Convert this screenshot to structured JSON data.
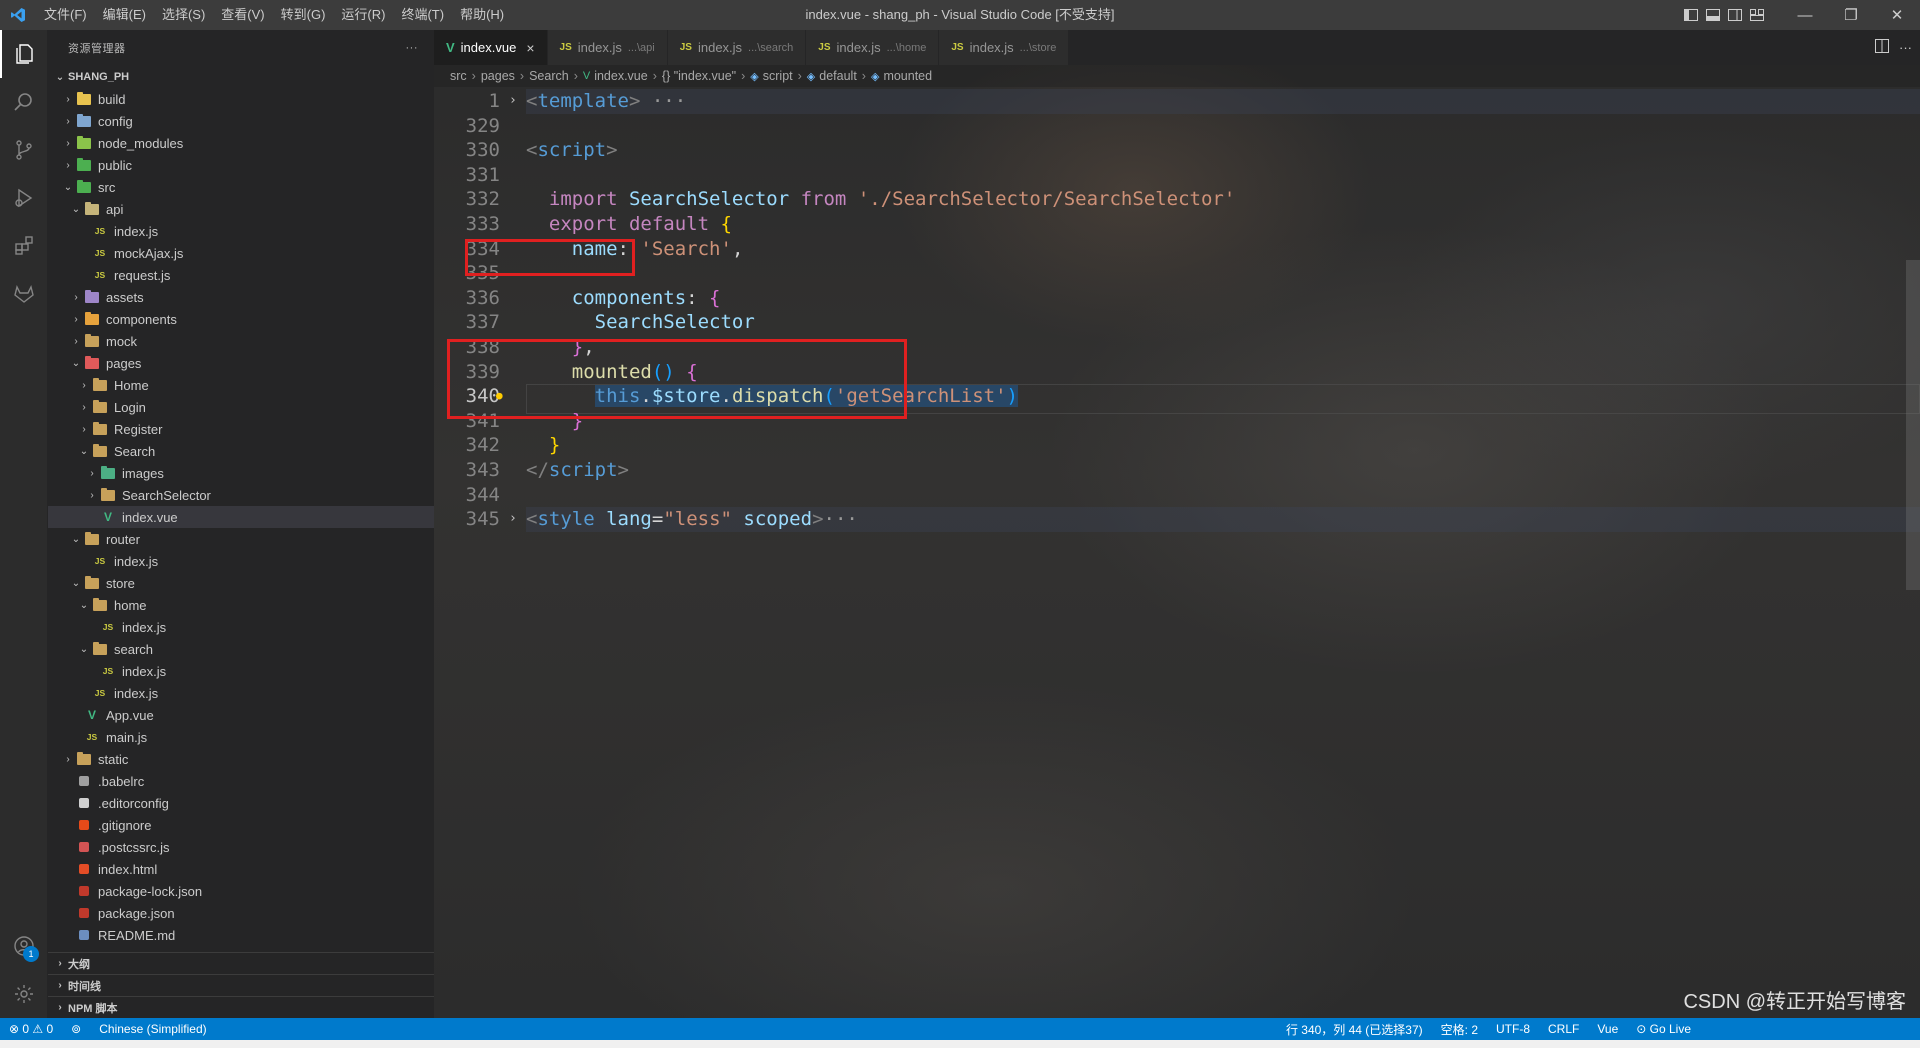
{
  "window": {
    "title": "index.vue - shang_ph - Visual Studio Code [不受支持]",
    "menu": [
      "文件(F)",
      "编辑(E)",
      "选择(S)",
      "查看(V)",
      "转到(G)",
      "运行(R)",
      "终端(T)",
      "帮助(H)"
    ]
  },
  "activity_bar": {
    "top": [
      "files-icon",
      "search-icon",
      "source-control-icon",
      "run-debug-icon",
      "extensions-icon",
      "gitlab-icon"
    ],
    "bottom": [
      "accounts-icon",
      "settings-gear-icon"
    ],
    "accounts_badge": "1"
  },
  "sidebar": {
    "title": "资源管理器",
    "more": "···",
    "tree": [
      {
        "label": "SHANG_PH",
        "depth": 0,
        "kind": "root",
        "open": true
      },
      {
        "label": "build",
        "depth": 1,
        "kind": "folder",
        "open": false,
        "color": "#e8c34f"
      },
      {
        "label": "config",
        "depth": 1,
        "kind": "folder",
        "open": false,
        "color": "#7fa6d0"
      },
      {
        "label": "node_modules",
        "depth": 1,
        "kind": "folder",
        "open": false,
        "color": "#8bc34a"
      },
      {
        "label": "public",
        "depth": 1,
        "kind": "folder",
        "open": false,
        "color": "#4caf50"
      },
      {
        "label": "src",
        "depth": 1,
        "kind": "folder",
        "open": true,
        "color": "#4caf50"
      },
      {
        "label": "api",
        "depth": 2,
        "kind": "folder",
        "open": true,
        "color": "#c5b47a"
      },
      {
        "label": "index.js",
        "depth": 3,
        "kind": "js"
      },
      {
        "label": "mockAjax.js",
        "depth": 3,
        "kind": "js"
      },
      {
        "label": "request.js",
        "depth": 3,
        "kind": "js"
      },
      {
        "label": "assets",
        "depth": 2,
        "kind": "folder",
        "open": false,
        "color": "#9e86c8"
      },
      {
        "label": "components",
        "depth": 2,
        "kind": "folder",
        "open": false,
        "color": "#e6a23c"
      },
      {
        "label": "mock",
        "depth": 2,
        "kind": "folder",
        "open": false,
        "color": "#c7a15a"
      },
      {
        "label": "pages",
        "depth": 2,
        "kind": "folder",
        "open": true,
        "color": "#e05a5a"
      },
      {
        "label": "Home",
        "depth": 3,
        "kind": "folder",
        "open": false,
        "color": "#c7a15a"
      },
      {
        "label": "Login",
        "depth": 3,
        "kind": "folder",
        "open": false,
        "color": "#c7a15a"
      },
      {
        "label": "Register",
        "depth": 3,
        "kind": "folder",
        "open": false,
        "color": "#c7a15a"
      },
      {
        "label": "Search",
        "depth": 3,
        "kind": "folder",
        "open": true,
        "color": "#c7a15a"
      },
      {
        "label": "images",
        "depth": 4,
        "kind": "folder",
        "open": false,
        "color": "#4caf84"
      },
      {
        "label": "SearchSelector",
        "depth": 4,
        "kind": "folder",
        "open": false,
        "color": "#c7a15a"
      },
      {
        "label": "index.vue",
        "depth": 4,
        "kind": "vue",
        "selected": true
      },
      {
        "label": "router",
        "depth": 2,
        "kind": "folder",
        "open": true,
        "color": "#c7a15a"
      },
      {
        "label": "index.js",
        "depth": 3,
        "kind": "js"
      },
      {
        "label": "store",
        "depth": 2,
        "kind": "folder",
        "open": true,
        "color": "#c7a15a"
      },
      {
        "label": "home",
        "depth": 3,
        "kind": "folder",
        "open": true,
        "color": "#c7a15a"
      },
      {
        "label": "index.js",
        "depth": 4,
        "kind": "js"
      },
      {
        "label": "search",
        "depth": 3,
        "kind": "folder",
        "open": true,
        "color": "#c7a15a"
      },
      {
        "label": "index.js",
        "depth": 4,
        "kind": "js"
      },
      {
        "label": "index.js",
        "depth": 3,
        "kind": "js"
      },
      {
        "label": "App.vue",
        "depth": 2,
        "kind": "vue"
      },
      {
        "label": "main.js",
        "depth": 2,
        "kind": "js"
      },
      {
        "label": "static",
        "depth": 1,
        "kind": "folder",
        "open": false,
        "color": "#c7a15a"
      },
      {
        "label": ".babelrc",
        "depth": 1,
        "kind": "file",
        "color": "#a0a0a0"
      },
      {
        "label": ".editorconfig",
        "depth": 1,
        "kind": "file",
        "color": "#d0d0d0"
      },
      {
        "label": ".gitignore",
        "depth": 1,
        "kind": "file",
        "color": "#e64a19"
      },
      {
        "label": ".postcssrc.js",
        "depth": 1,
        "kind": "file",
        "color": "#d35454"
      },
      {
        "label": "index.html",
        "depth": 1,
        "kind": "file",
        "color": "#e44d26"
      },
      {
        "label": "package-lock.json",
        "depth": 1,
        "kind": "file",
        "color": "#c0392b"
      },
      {
        "label": "package.json",
        "depth": 1,
        "kind": "file",
        "color": "#c0392b"
      },
      {
        "label": "README.md",
        "depth": 1,
        "kind": "file",
        "color": "#6c8ebf"
      }
    ],
    "sections": [
      "大纲",
      "时间线",
      "NPM 脚本"
    ]
  },
  "tabs": [
    {
      "icon": "V",
      "label": "index.vue",
      "desc": "",
      "active": true,
      "close": "×"
    },
    {
      "icon": "JS",
      "label": "index.js",
      "desc": "...\\api",
      "active": false
    },
    {
      "icon": "JS",
      "label": "index.js",
      "desc": "...\\search",
      "active": false
    },
    {
      "icon": "JS",
      "label": "index.js",
      "desc": "...\\home",
      "active": false
    },
    {
      "icon": "JS",
      "label": "index.js",
      "desc": "...\\store",
      "active": false
    }
  ],
  "breadcrumb": [
    "src",
    "pages",
    "Search",
    "index.vue",
    "{} \"index.vue\"",
    "script",
    "default",
    "mounted"
  ],
  "code_lines": [
    {
      "n": "1",
      "fold": "›",
      "folded": true,
      "tokens": [
        [
          "t-punc",
          "<"
        ],
        [
          "t-tag",
          "template"
        ],
        [
          "t-punc",
          ">"
        ],
        [
          "t-ell",
          " ···"
        ]
      ]
    },
    {
      "n": "329",
      "tokens": []
    },
    {
      "n": "330",
      "tokens": [
        [
          "t-punc",
          "<"
        ],
        [
          "t-tag",
          "script"
        ],
        [
          "t-punc",
          ">"
        ]
      ]
    },
    {
      "n": "331",
      "tokens": []
    },
    {
      "n": "332",
      "tokens": [
        [
          "t-plain",
          "  "
        ],
        [
          "t-kw",
          "import"
        ],
        [
          "t-plain",
          " "
        ],
        [
          "t-var",
          "SearchSelector"
        ],
        [
          "t-plain",
          " "
        ],
        [
          "t-kw",
          "from"
        ],
        [
          "t-plain",
          " "
        ],
        [
          "t-str",
          "'./SearchSelector/SearchSelector'"
        ]
      ]
    },
    {
      "n": "333",
      "tokens": [
        [
          "t-plain",
          "  "
        ],
        [
          "t-kw",
          "export"
        ],
        [
          "t-plain",
          " "
        ],
        [
          "t-kw",
          "default"
        ],
        [
          "t-plain",
          " "
        ],
        [
          "t-brace",
          "{"
        ]
      ]
    },
    {
      "n": "334",
      "tokens": [
        [
          "t-plain",
          "    "
        ],
        [
          "t-var",
          "name"
        ],
        [
          "t-plain",
          ": "
        ],
        [
          "t-str",
          "'Search'"
        ],
        [
          "t-plain",
          ","
        ]
      ]
    },
    {
      "n": "335",
      "tokens": []
    },
    {
      "n": "336",
      "tokens": [
        [
          "t-plain",
          "    "
        ],
        [
          "t-var",
          "components"
        ],
        [
          "t-plain",
          ": "
        ],
        [
          "t-brace2",
          "{"
        ]
      ]
    },
    {
      "n": "337",
      "tokens": [
        [
          "t-plain",
          "      "
        ],
        [
          "t-var",
          "SearchSelector"
        ]
      ]
    },
    {
      "n": "338",
      "tokens": [
        [
          "t-plain",
          "    "
        ],
        [
          "t-brace2",
          "}"
        ],
        [
          "t-plain",
          ","
        ]
      ]
    },
    {
      "n": "339",
      "tokens": [
        [
          "t-plain",
          "    "
        ],
        [
          "t-fn",
          "mounted"
        ],
        [
          "t-brace3",
          "()"
        ],
        [
          "t-plain",
          " "
        ],
        [
          "t-brace2",
          "{"
        ]
      ]
    },
    {
      "n": "340",
      "current": true,
      "tokens": [
        [
          "t-plain",
          "      "
        ],
        [
          "t-this sel",
          "this"
        ],
        [
          "t-plain sel",
          "."
        ],
        [
          "t-var sel",
          "$store"
        ],
        [
          "t-plain sel",
          "."
        ],
        [
          "t-fn sel",
          "dispatch"
        ],
        [
          "t-brace3 sel",
          "("
        ],
        [
          "t-str sel",
          "'getSearchList'"
        ],
        [
          "t-brace3 sel",
          ")"
        ]
      ]
    },
    {
      "n": "341",
      "tokens": [
        [
          "t-plain",
          "    "
        ],
        [
          "t-brace2",
          "}"
        ]
      ]
    },
    {
      "n": "342",
      "tokens": [
        [
          "t-plain",
          "  "
        ],
        [
          "t-brace",
          "}"
        ]
      ]
    },
    {
      "n": "343",
      "tokens": [
        [
          "t-punc",
          "</"
        ],
        [
          "t-tag",
          "script"
        ],
        [
          "t-punc",
          ">"
        ]
      ]
    },
    {
      "n": "344",
      "tokens": []
    },
    {
      "n": "345",
      "fold": "›",
      "folded": true,
      "tokens": [
        [
          "t-punc",
          "<"
        ],
        [
          "t-tag",
          "style"
        ],
        [
          "t-plain",
          " "
        ],
        [
          "t-attr",
          "lang"
        ],
        [
          "t-plain",
          "="
        ],
        [
          "t-str",
          "\"less\""
        ],
        [
          "t-plain",
          " "
        ],
        [
          "t-attr",
          "scoped"
        ],
        [
          "t-punc",
          ">"
        ],
        [
          "t-ell",
          "···"
        ]
      ]
    }
  ],
  "statusbar": {
    "errors": "⊗ 0",
    "warnings": "⚠ 0",
    "language_pack": "Chinese (Simplified)",
    "cursor": "行 340，列 44 (已选择37)",
    "spaces": "空格: 2",
    "encoding": "UTF-8",
    "eol": "CRLF",
    "mode": "Vue",
    "golive": "⊙ Go Live",
    "watermark": "CSDN @转正开始写博客"
  }
}
